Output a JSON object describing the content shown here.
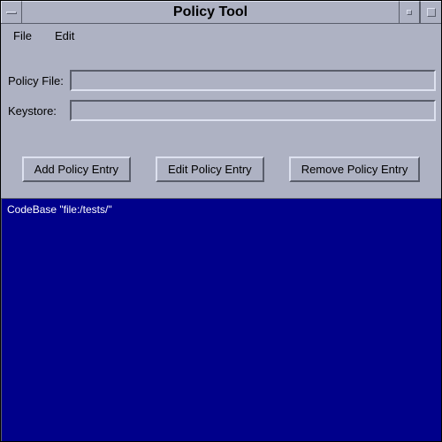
{
  "window": {
    "title": "Policy Tool"
  },
  "menu": {
    "file": "File",
    "edit": "Edit"
  },
  "form": {
    "policy_file_label": "Policy File:",
    "policy_file_value": "",
    "keystore_label": "Keystore:",
    "keystore_value": ""
  },
  "buttons": {
    "add": "Add Policy Entry",
    "edit": "Edit Policy Entry",
    "remove": "Remove Policy Entry"
  },
  "entries": [
    "CodeBase \"file:/tests/\""
  ]
}
